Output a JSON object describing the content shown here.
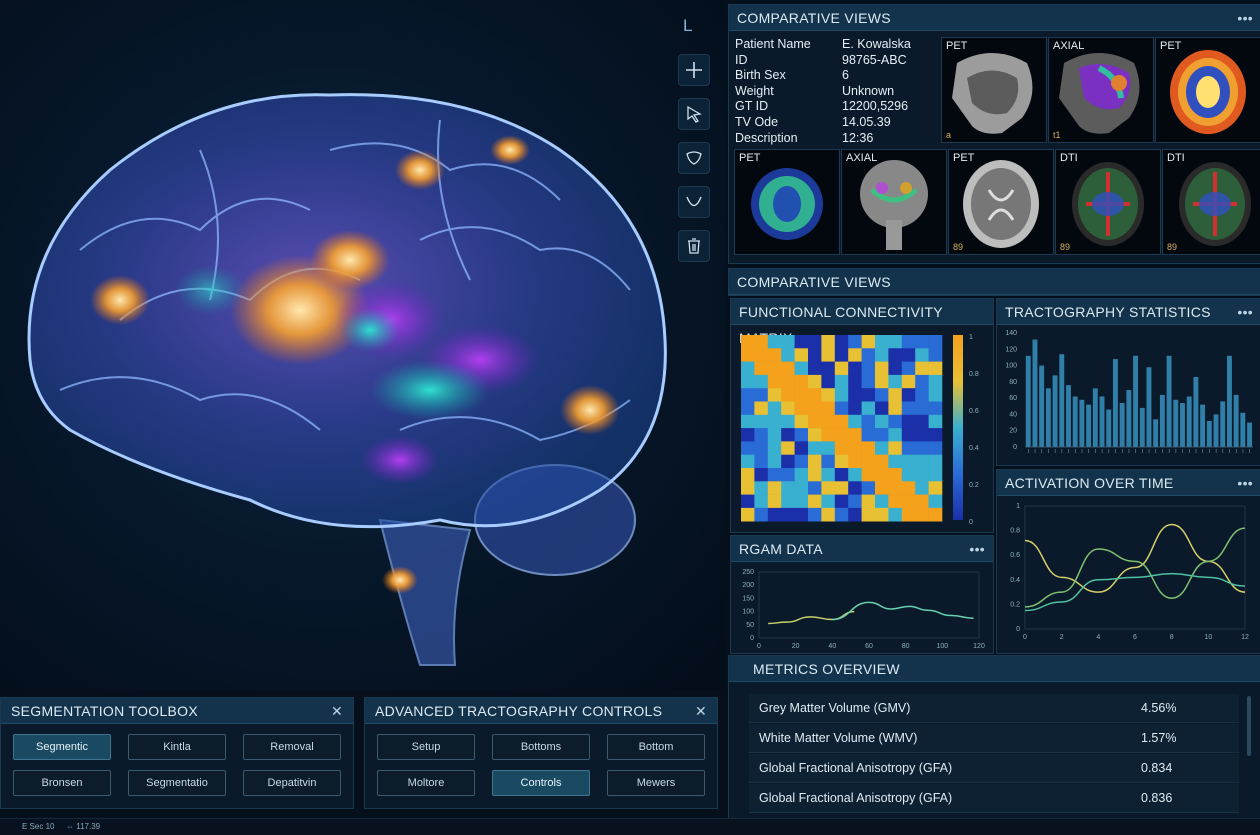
{
  "toolbar": {
    "label": "L",
    "tools": [
      {
        "icon": "plus-icon"
      },
      {
        "icon": "cursor-icon"
      },
      {
        "icon": "lasso-icon"
      },
      {
        "icon": "curve-icon"
      },
      {
        "icon": "trash-icon"
      }
    ]
  },
  "comparative_top": {
    "title": "COMPARATIVE VIEWS",
    "patient": [
      {
        "label": "Patient Name",
        "value": "E. Kowalska"
      },
      {
        "label": "ID",
        "value": "98765-ABC"
      },
      {
        "label": "Birth Sex",
        "value": "6"
      },
      {
        "label": "Weight",
        "value": "Unknown"
      },
      {
        "label": "GT ID",
        "value": "12200,5296"
      },
      {
        "label": "TV Ode",
        "value": "14.05.39"
      },
      {
        "label": "Description",
        "value": "12:36"
      }
    ],
    "thumbs_row1": [
      {
        "label": "PET",
        "badge": "a"
      },
      {
        "label": "AXIAL",
        "badge": "t1"
      },
      {
        "label": "PET",
        "badge": ""
      }
    ],
    "thumbs_row2": [
      {
        "label": "PET",
        "badge": ""
      },
      {
        "label": "AXIAL",
        "badge": ""
      },
      {
        "label": "PET",
        "badge": "89"
      },
      {
        "label": "DTI",
        "badge": "89"
      },
      {
        "label": "DTI",
        "badge": "89"
      }
    ]
  },
  "comparative_mid": {
    "title": "COMPARATIVE VIEWS"
  },
  "fcm": {
    "title": "FUNCTIONAL CONNECTIVITY MATRIX",
    "colorbar_ticks": [
      "1",
      "0.8",
      "0.6",
      "0.4",
      "0.2",
      "0"
    ]
  },
  "tract": {
    "title": "TRACTOGRAPHY STATISTICS"
  },
  "rgam": {
    "title": "RGAM DATA"
  },
  "activation": {
    "title": "ACTIVATION OVER TIME"
  },
  "segmentation": {
    "title": "SEGMENTATION TOOLBOX",
    "buttons": [
      "Segmentic",
      "Kintla",
      "Removal",
      "Bronsen",
      "Segmentatio",
      "Depatitvin"
    ]
  },
  "advanced": {
    "title": "ADVANCED TRACTOGRAPHY CONTROLS",
    "buttons": [
      "Setup",
      "Bottoms",
      "Bottom",
      "Moltore",
      "Controls",
      "Mewers"
    ]
  },
  "metrics": {
    "title": "METRICS OVERVIEW",
    "rows": [
      {
        "label": "Grey Matter Volume (GMV)",
        "value": "4.56%"
      },
      {
        "label": "White Matter Volume (WMV)",
        "value": "1.57%"
      },
      {
        "label": "Global Fractional Anisotropy (GFA)",
        "value": "0.834"
      },
      {
        "label": "Global Fractional Anisotropy (GFA)",
        "value": "0.836"
      }
    ]
  },
  "statusbar": {
    "left": "E Sec 10",
    "right": "⇔ 117.39"
  },
  "chart_data": [
    {
      "type": "heatmap",
      "title": "FUNCTIONAL CONNECTIVITY MATRIX",
      "size": [
        15,
        14
      ],
      "colorscale": [
        "#1b2fa8",
        "#2a6cd6",
        "#3ab0d0",
        "#e8c033",
        "#f4a11c"
      ],
      "clim": [
        0,
        1
      ]
    },
    {
      "type": "bar",
      "title": "TRACTOGRAPHY STATISTICS",
      "ylim": [
        0,
        140
      ],
      "yticks": [
        0,
        20,
        40,
        60,
        80,
        100,
        120,
        140
      ],
      "values": [
        112,
        132,
        100,
        72,
        88,
        114,
        76,
        62,
        58,
        52,
        72,
        62,
        46,
        108,
        54,
        70,
        112,
        48,
        98,
        34,
        64,
        112,
        58,
        54,
        62,
        86,
        52,
        32,
        40,
        56,
        112,
        64,
        42,
        30
      ],
      "color": "#2f7fa8"
    },
    {
      "type": "line",
      "title": "RGAM DATA",
      "xlim": [
        0,
        120
      ],
      "ylim": [
        0,
        250
      ],
      "xticks": [
        0,
        20,
        40,
        60,
        80,
        100,
        120
      ],
      "yticks": [
        0,
        50,
        100,
        150,
        200,
        250
      ],
      "series": [
        {
          "color": "#c8d26a",
          "values": [
            [
              5,
              55
            ],
            [
              15,
              60
            ],
            [
              28,
              80
            ],
            [
              40,
              70
            ],
            [
              52,
              100
            ]
          ]
        },
        {
          "color": "#6ad0b0",
          "values": [
            [
              40,
              70
            ],
            [
              60,
              135
            ],
            [
              72,
              110
            ],
            [
              82,
              120
            ],
            [
              92,
              105
            ],
            [
              105,
              85
            ],
            [
              117,
              75
            ]
          ]
        }
      ]
    },
    {
      "type": "line",
      "title": "ACTIVATION OVER TIME",
      "xlim": [
        0,
        12
      ],
      "ylim": [
        0,
        1
      ],
      "xticks": [
        0,
        2,
        4,
        6,
        8,
        10,
        12
      ],
      "yticks": [
        0,
        0.2,
        0.4,
        0.6,
        0.8,
        1
      ],
      "series": [
        {
          "color": "#d8cf6a",
          "values": [
            [
              0,
              0.72
            ],
            [
              2,
              0.42
            ],
            [
              4,
              0.3
            ],
            [
              6,
              0.5
            ],
            [
              8,
              0.85
            ],
            [
              10,
              0.55
            ],
            [
              12,
              0.3
            ]
          ]
        },
        {
          "color": "#80c070",
          "values": [
            [
              0,
              0.18
            ],
            [
              2,
              0.3
            ],
            [
              4,
              0.65
            ],
            [
              6,
              0.55
            ],
            [
              8,
              0.25
            ],
            [
              10,
              0.55
            ],
            [
              12,
              0.82
            ]
          ]
        },
        {
          "color": "#50c0a0",
          "values": [
            [
              0,
              0.15
            ],
            [
              2,
              0.22
            ],
            [
              4,
              0.4
            ],
            [
              6,
              0.42
            ],
            [
              8,
              0.45
            ],
            [
              10,
              0.42
            ],
            [
              12,
              0.35
            ]
          ]
        }
      ]
    }
  ]
}
